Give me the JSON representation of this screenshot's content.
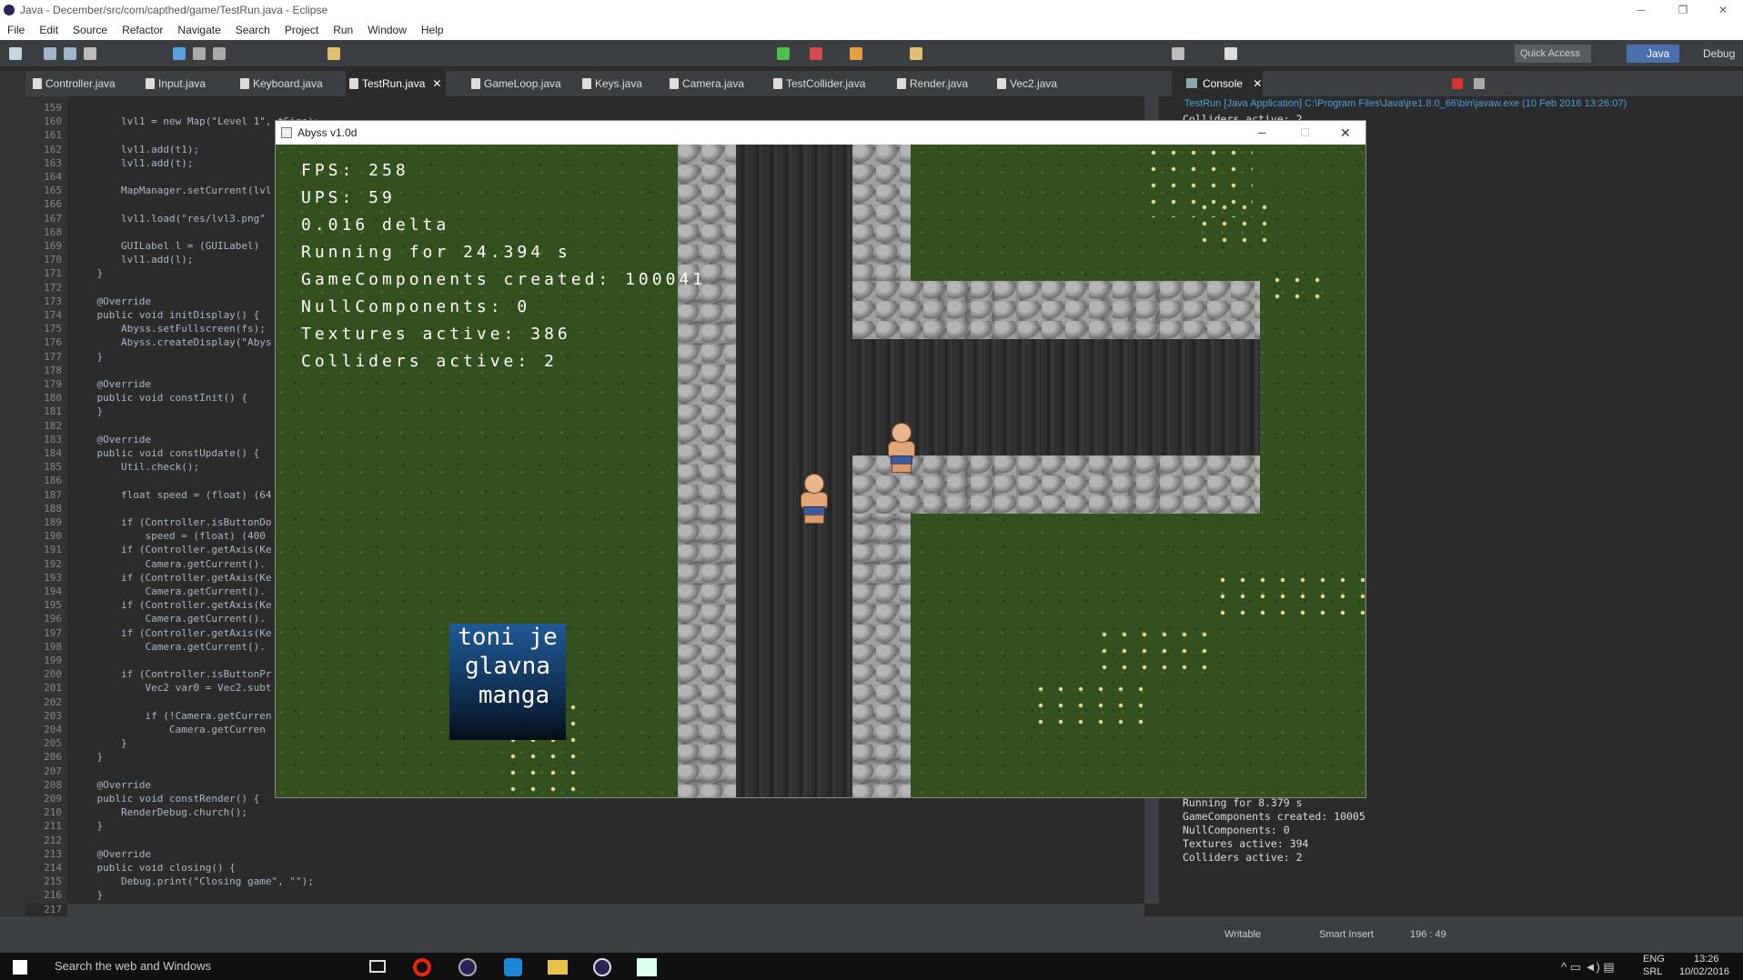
{
  "eclipse": {
    "title": "Java - December/src/com/capthed/game/TestRun.java - Eclipse",
    "menu": [
      "File",
      "Edit",
      "Source",
      "Refactor",
      "Navigate",
      "Search",
      "Project",
      "Run",
      "Window",
      "Help"
    ],
    "quick_access": "Quick Access",
    "perspectives": [
      "Java",
      "Debug"
    ],
    "tabs": [
      "Controller.java",
      "Input.java",
      "Keyboard.java",
      "TestRun.java",
      "GameLoop.java",
      "Keys.java",
      "Camera.java",
      "TestCollider.java",
      "Render.java",
      "Vec2.java"
    ],
    "active_tab": "TestRun.java",
    "console_tab": "Console",
    "console_header": "TestRun [Java Application] C:\\Program Files\\Java\\jre1.8.0_66\\bin\\javaw.exe (10 Feb 2016 13:26:07)",
    "console_first_line": "Colliders active: 2",
    "console_lines": [
      "Running for 8.379 s",
      "GameComponents created: 10005",
      "NullComponents: 0",
      "Textures active: 394",
      "Colliders active: 2"
    ],
    "status": {
      "writable": "Writable",
      "insert": "Smart Insert",
      "position": "196 : 49"
    }
  },
  "code_lines": [
    {
      "n": "159",
      "t": ""
    },
    {
      "n": "160",
      "t": "        lvl1 = new Map(\"Level 1\", tSize);"
    },
    {
      "n": "161",
      "t": ""
    },
    {
      "n": "162",
      "t": "        lvl1.add(t1);"
    },
    {
      "n": "163",
      "t": "        lvl1.add(t);"
    },
    {
      "n": "164",
      "t": ""
    },
    {
      "n": "165",
      "t": "        MapManager.setCurrent(lvl"
    },
    {
      "n": "166",
      "t": ""
    },
    {
      "n": "167",
      "t": "        lvl1.load(\"res/lvl3.png\""
    },
    {
      "n": "168",
      "t": ""
    },
    {
      "n": "169",
      "t": "        GUILabel l = (GUILabel) "
    },
    {
      "n": "170",
      "t": "        lvl1.add(l);"
    },
    {
      "n": "171",
      "t": "    }"
    },
    {
      "n": "172",
      "t": ""
    },
    {
      "n": "173",
      "t": "    @Override"
    },
    {
      "n": "174",
      "t": "    public void initDisplay() {"
    },
    {
      "n": "175",
      "t": "        Abyss.setFullscreen(fs);"
    },
    {
      "n": "176",
      "t": "        Abyss.createDisplay(\"Abys"
    },
    {
      "n": "177",
      "t": "    }"
    },
    {
      "n": "178",
      "t": ""
    },
    {
      "n": "179",
      "t": "    @Override"
    },
    {
      "n": "180",
      "t": "    public void constInit() {"
    },
    {
      "n": "181",
      "t": "    }"
    },
    {
      "n": "182",
      "t": ""
    },
    {
      "n": "183",
      "t": "    @Override"
    },
    {
      "n": "184",
      "t": "    public void constUpdate() {"
    },
    {
      "n": "185",
      "t": "        Util.check();"
    },
    {
      "n": "186",
      "t": ""
    },
    {
      "n": "187",
      "t": "        float speed = (float) (64"
    },
    {
      "n": "188",
      "t": ""
    },
    {
      "n": "189",
      "t": "        if (Controller.isButtonDo"
    },
    {
      "n": "190",
      "t": "            speed = (float) (400"
    },
    {
      "n": "191",
      "t": "        if (Controller.getAxis(Ke"
    },
    {
      "n": "192",
      "t": "            Camera.getCurrent()."
    },
    {
      "n": "193",
      "t": "        if (Controller.getAxis(Ke"
    },
    {
      "n": "194",
      "t": "            Camera.getCurrent()."
    },
    {
      "n": "195",
      "t": "        if (Controller.getAxis(Ke"
    },
    {
      "n": "196",
      "t": "            Camera.getCurrent()."
    },
    {
      "n": "197",
      "t": "        if (Controller.getAxis(Ke"
    },
    {
      "n": "198",
      "t": "            Camera.getCurrent()."
    },
    {
      "n": "199",
      "t": ""
    },
    {
      "n": "200",
      "t": "        if (Controller.isButtonPr"
    },
    {
      "n": "201",
      "t": "            Vec2 var0 = Vec2.subt"
    },
    {
      "n": "202",
      "t": ""
    },
    {
      "n": "203",
      "t": "            if (!Camera.getCurren"
    },
    {
      "n": "204",
      "t": "                Camera.getCurren"
    },
    {
      "n": "205",
      "t": "        }"
    },
    {
      "n": "206",
      "t": "    }"
    },
    {
      "n": "207",
      "t": ""
    },
    {
      "n": "208",
      "t": "    @Override"
    },
    {
      "n": "209",
      "t": "    public void constRender() {"
    },
    {
      "n": "210",
      "t": "        RenderDebug.church();"
    },
    {
      "n": "211",
      "t": "    }"
    },
    {
      "n": "212",
      "t": ""
    },
    {
      "n": "213",
      "t": "    @Override"
    },
    {
      "n": "214",
      "t": "    public void closing() {"
    },
    {
      "n": "215",
      "t": "        Debug.print(\"Closing game\", \"\");"
    },
    {
      "n": "216",
      "t": "    }"
    },
    {
      "n": "217",
      "t": "}"
    }
  ],
  "game": {
    "title": "Abyss v1.0d",
    "hud": [
      "FPS: 258",
      "UPS: 59",
      "0.016 delta",
      "Running for 24.394 s",
      "GameComponents created: 100041",
      "NullComponents: 0",
      "Textures active: 386",
      "Colliders active: 2"
    ],
    "sign": [
      "toni je",
      "glavna",
      "manga"
    ]
  },
  "taskbar": {
    "search": "Search the web and Windows",
    "lang1": "ENG",
    "lang2": "SRL",
    "time": "13:26",
    "date": "10/02/2016"
  },
  "colors": {
    "accent": "#4b6eaf",
    "editor_bg": "#2b2b2b",
    "grass": "#34501f"
  }
}
